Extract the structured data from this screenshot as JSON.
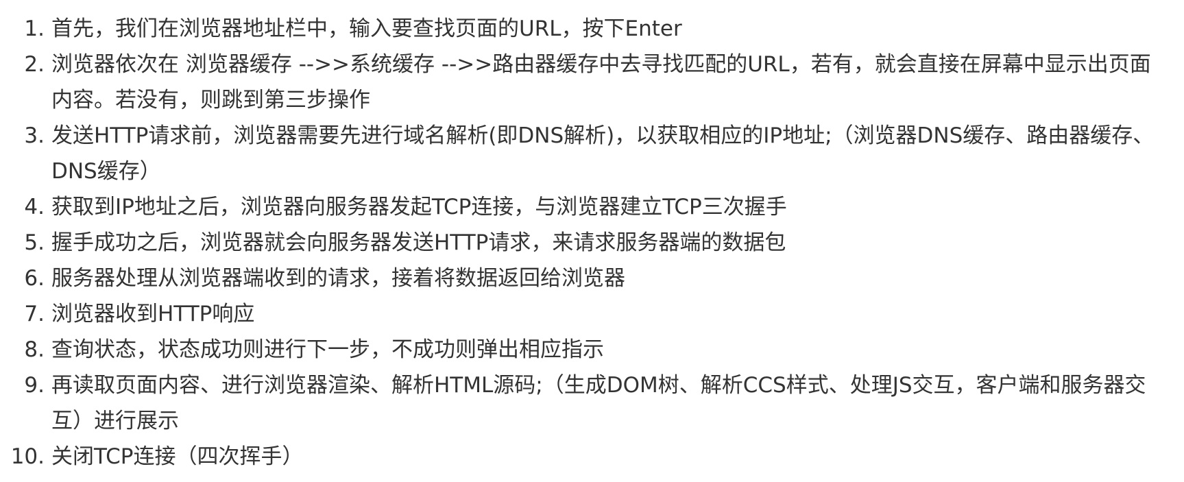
{
  "steps": [
    {
      "num": "1.",
      "text": "首先，我们在浏览器地址栏中，输入要查找页面的URL，按下Enter"
    },
    {
      "num": "2.",
      "text": "浏览器依次在 浏览器缓存 -->>系统缓存 -->>路由器缓存中去寻找匹配的URL，若有，就会直接在屏幕中显示出页面内容。若没有，则跳到第三步操作"
    },
    {
      "num": "3.",
      "text": "发送HTTP请求前，浏览器需要先进行域名解析(即DNS解析)，以获取相应的IP地址;（浏览器DNS缓存、路由器缓存、DNS缓存）"
    },
    {
      "num": "4.",
      "text": "获取到IP地址之后，浏览器向服务器发起TCP连接，与浏览器建立TCP三次握手"
    },
    {
      "num": "5.",
      "text": "握手成功之后，浏览器就会向服务器发送HTTP请求，来请求服务器端的数据包"
    },
    {
      "num": "6.",
      "text": "服务器处理从浏览器端收到的请求，接着将数据返回给浏览器"
    },
    {
      "num": "7.",
      "text": "浏览器收到HTTP响应"
    },
    {
      "num": "8.",
      "text": "查询状态，状态成功则进行下一步，不成功则弹出相应指示"
    },
    {
      "num": "9.",
      "text": "再读取页面内容、进行浏览器渲染、解析HTML源码;（生成DOM树、解析CCS样式、处理JS交互，客户端和服务器交互）进行展示"
    },
    {
      "num": "10.",
      "text": "关闭TCP连接（四次挥手）"
    }
  ]
}
